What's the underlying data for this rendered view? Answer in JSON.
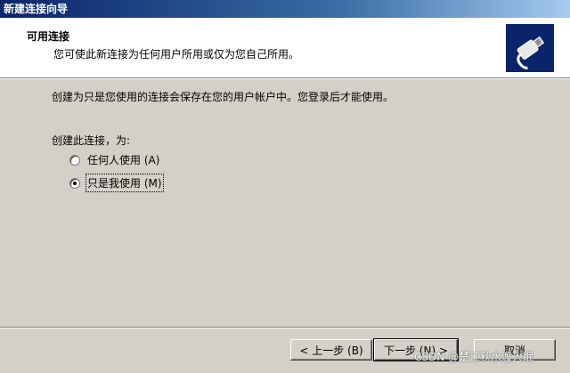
{
  "window": {
    "title": "新建连接向导"
  },
  "header": {
    "title": "可用连接",
    "subtitle": "您可使此新连接为任何用户所用或仅为您自己所用。",
    "icon": "network-connection-icon"
  },
  "body": {
    "description": "创建为只是您使用的连接会保存在您的用户帐户中。您登录后才能使用。",
    "create_label": "创建此连接，为:",
    "options": [
      {
        "label": "任何人使用 (A)",
        "checked": false
      },
      {
        "label": "只是我使用 (M)",
        "checked": true
      }
    ]
  },
  "footer": {
    "back_label": "< 上一步 (B)",
    "next_label": "下一步 (N) >",
    "cancel_label": "取消"
  },
  "watermark": "CSDN @楚江秋水渡人眠",
  "colors": {
    "title_bar": "#0a246a",
    "dialog_bg": "#d4d0c8",
    "header_bg": "#ffffff"
  }
}
